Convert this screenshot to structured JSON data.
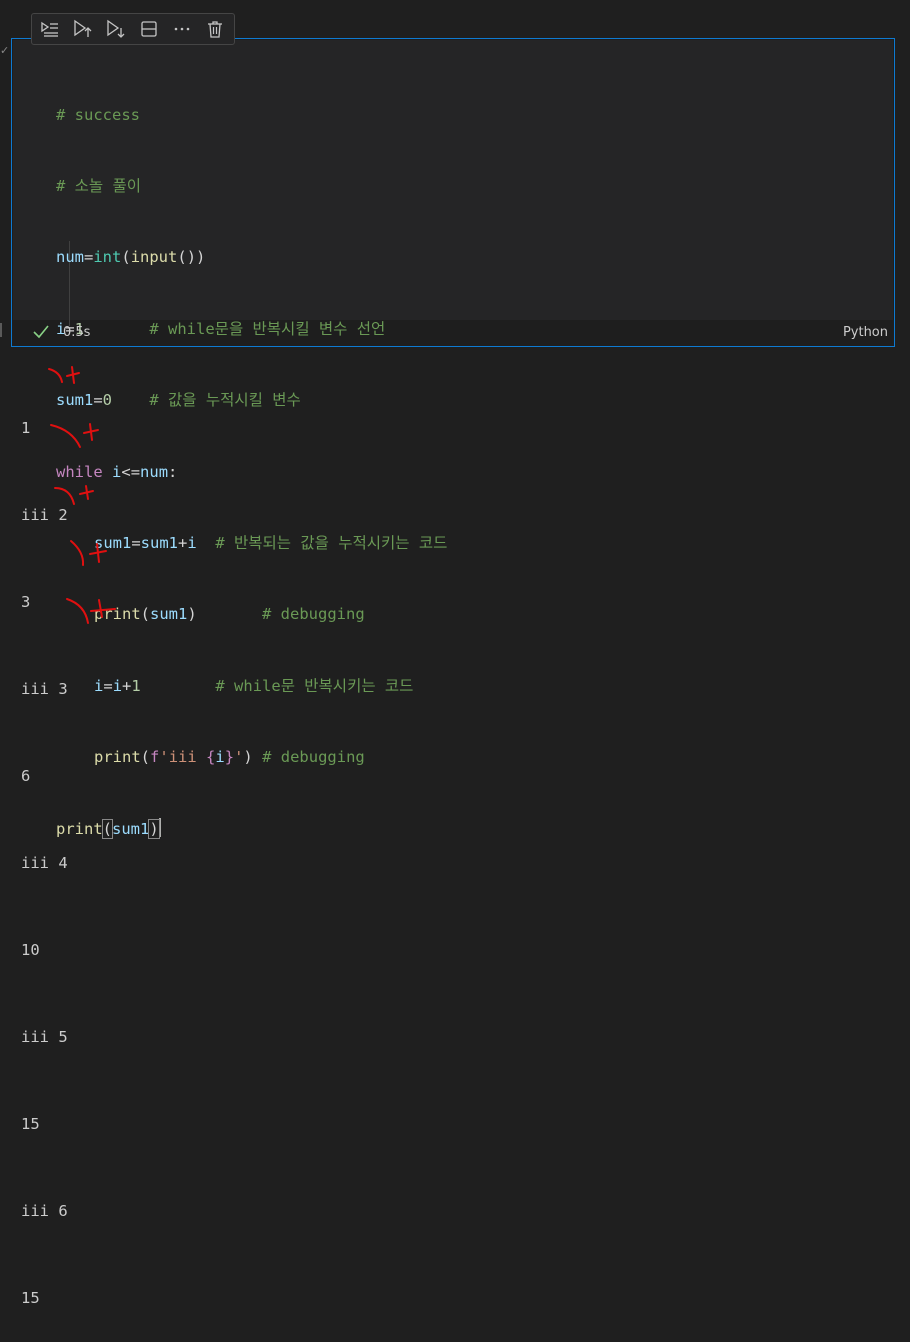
{
  "toolbar": {
    "buttons": [
      {
        "name": "execute-above-and-cell",
        "icon": "run-by-line-icon"
      },
      {
        "name": "execute-above",
        "icon": "execute-above-icon"
      },
      {
        "name": "execute-below",
        "icon": "execute-below-icon"
      },
      {
        "name": "split-cell",
        "icon": "split-cell-icon"
      },
      {
        "name": "more-actions",
        "icon": "ellipsis-icon"
      },
      {
        "name": "delete-cell",
        "icon": "trash-icon"
      }
    ]
  },
  "code": {
    "lines": [
      "# success",
      "# 소놀 풀이",
      "num=int(input())",
      "i=1       # while문을 반복시킬 변수 선언",
      "sum1=0    # 값을 누적시킬 변수",
      "while i<=num:",
      "    sum1=sum1+i  # 반복되는 값을 누적시키는 코드",
      "    print(sum1)       # debugging",
      "    i=i+1        # while문 반복시키는 코드",
      "    print(f'iii {i}') # debugging",
      "print(sum1)"
    ],
    "tokens": {
      "l1_comment": "# success",
      "l2_comment": "# 소놀 풀이",
      "l3_var": "num",
      "l3_eq": "=",
      "l3_int": "int",
      "l3_p1": "(",
      "l3_input": "input",
      "l3_p2": "())",
      "l4_var": "i",
      "l4_eq": "=",
      "l4_num": "1",
      "l4_sp": "       ",
      "l4_comment": "# while문을 반복시킬 변수 선언",
      "l5_var": "sum1",
      "l5_eq": "=",
      "l5_num": "0",
      "l5_sp": "    ",
      "l5_comment": "# 값을 누적시킬 변수",
      "l6_kw": "while",
      "l6_sp": " ",
      "l6_i": "i",
      "l6_op": "<=",
      "l6_num": "num",
      "l6_colon": ":",
      "l7_a": "sum1",
      "l7_eq": "=",
      "l7_b": "sum1",
      "l7_plus": "+",
      "l7_i": "i",
      "l7_sp": "  ",
      "l7_comment": "# 반복되는 값을 누적시키는 코드",
      "l8_fn": "print",
      "l8_p1": "(",
      "l8_var": "sum1",
      "l8_p2": ")",
      "l8_sp": "       ",
      "l8_comment": "# debugging",
      "l9_i": "i",
      "l9_eq": "=",
      "l9_i2": "i",
      "l9_plus": "+",
      "l9_num": "1",
      "l9_sp": "        ",
      "l9_comment": "# while문 반복시키는 코드",
      "l10_fn": "print",
      "l10_p1": "(",
      "l10_f": "f",
      "l10_str1": "'iii ",
      "l10_br1": "{",
      "l10_i": "i",
      "l10_br2": "}",
      "l10_str2": "'",
      "l10_p2": ")",
      "l10_sp": " ",
      "l10_comment": "# debugging",
      "l11_fn": "print",
      "l11_p1": "(",
      "l11_var": "sum1",
      "l11_p2": ")"
    }
  },
  "status": {
    "exec_time": "0.5s",
    "language": "Python"
  },
  "output": {
    "lines": [
      "1",
      "iii 2",
      "3",
      "iii 3",
      "6",
      "iii 4",
      "10",
      "iii 5",
      "15",
      "iii 6",
      "15"
    ]
  },
  "colors": {
    "accent_border": "#0e7ad1",
    "check": "#89d185",
    "annotation": "#e01010"
  }
}
